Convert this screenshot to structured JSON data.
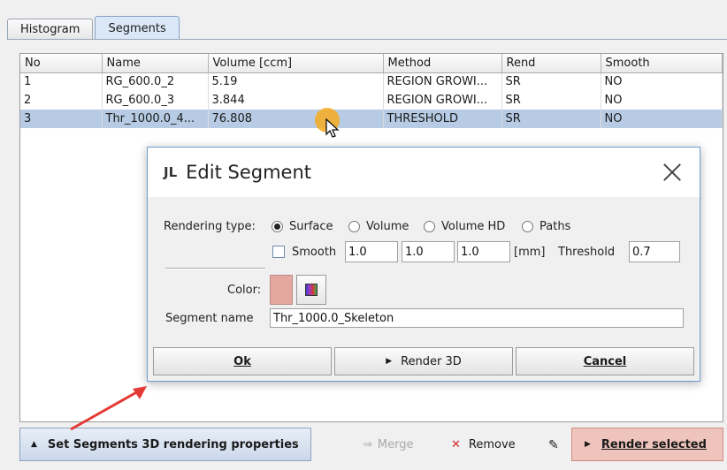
{
  "tabs": [
    {
      "label": "Histogram"
    },
    {
      "label": "Segments"
    }
  ],
  "table": {
    "columns": [
      "No",
      "Name",
      "Volume [ccm]",
      "Method",
      "Rend",
      "Smooth"
    ],
    "rows": [
      [
        "1",
        "RG_600.0_2",
        "5.19",
        "REGION GROWI...",
        "SR",
        "NO"
      ],
      [
        "2",
        "RG_600.0_3",
        "3.844",
        "REGION GROWI...",
        "SR",
        "NO"
      ],
      [
        "3",
        "Thr_1000.0_4...",
        "76.808",
        "THRESHOLD",
        "SR",
        "NO"
      ]
    ]
  },
  "dialog": {
    "title": "Edit Segment",
    "title_icon": "JL",
    "rendering_type_label": "Rendering type:",
    "rendering_options": [
      "Surface",
      "Volume",
      "Volume HD",
      "Paths"
    ],
    "selected_rendering": "Surface",
    "smooth_label": "Smooth",
    "smooth_checked": false,
    "smooth_values": [
      "1.0",
      "1.0",
      "1.0"
    ],
    "unit_label": "[mm]",
    "threshold_label": "Threshold",
    "threshold_value": "0.7",
    "color_label": "Color:",
    "color_value": "#e4a8a0",
    "segment_name_label": "Segment name",
    "segment_name_value": "Thr_1000.0_Skeleton",
    "ok_label": "Ok",
    "render_label": "Render 3D",
    "cancel_label": "Cancel"
  },
  "bottom": {
    "set_props_label": "Set Segments 3D rendering properties",
    "merge_label": "Merge",
    "remove_label": "Remove",
    "render_selected_label": "Render selected"
  },
  "colors": {
    "selection": "#b7cce4",
    "render_button": "#efc4bc",
    "cursor_highlight": "#f7aa1e",
    "annotation_arrow": "#e53935"
  }
}
